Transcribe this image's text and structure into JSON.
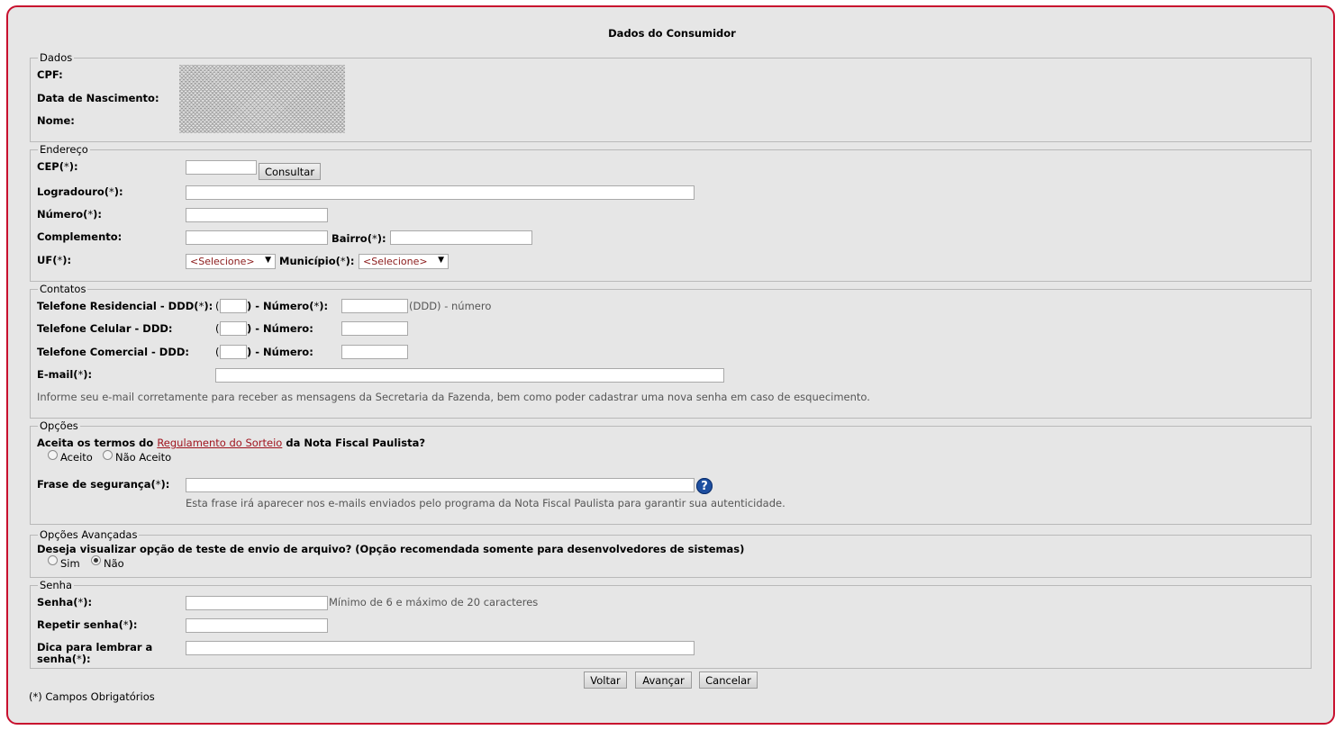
{
  "title": "Dados do Consumidor",
  "dados": {
    "legend": "Dados",
    "cpf_label": "CPF:",
    "nascimento_label": "Data de Nascimento:",
    "nome_label": "Nome:"
  },
  "endereco": {
    "legend": "Endereço",
    "cep_label": "CEP(",
    "logradouro_label": "Logradouro(",
    "numero_label": "Número(",
    "complemento_label": "Complemento:",
    "bairro_label": "Bairro(",
    "uf_label": "UF(",
    "municipio_label": "Município(",
    "consultar_button": "Consultar",
    "uf_selected": "<Selecione>",
    "municipio_selected": "<Selecione>"
  },
  "contatos": {
    "legend": "Contatos",
    "tel_res_label": "Telefone Residencial - DDD(",
    "tel_cel_label": "Telefone Celular - DDD:",
    "tel_com_label": "Telefone Comercial - DDD:",
    "numero_req_label": ") - Número(",
    "numero_label": ") - Número:",
    "paren_open": "(",
    "format_hint": "(DDD) - número",
    "email_label": "E-mail(",
    "email_hint": "Informe seu e-mail corretamente para receber as mensagens da Secretaria da Fazenda, bem como poder cadastrar uma nova senha em caso de esquecimento."
  },
  "opcoes": {
    "legend": "Opções",
    "question_prefix": "Aceita os termos do ",
    "question_link": "Regulamento do Sorteio",
    "question_suffix": " da Nota Fiscal Paulista?",
    "aceito_label": "Aceito",
    "nao_aceito_label": "Não Aceito",
    "frase_label": "Frase de segurança(",
    "frase_hint": "Esta frase irá aparecer nos e-mails enviados pelo programa da Nota Fiscal Paulista para garantir sua autenticidade."
  },
  "avancadas": {
    "legend": "Opções Avançadas",
    "question": "Deseja visualizar opção de teste de envio de arquivo? (Opção recomendada somente para desenvolvedores de sistemas)",
    "sim_label": "Sim",
    "nao_label": "Não",
    "selected": "Não"
  },
  "senha": {
    "legend": "Senha",
    "senha_label": "Senha(",
    "senha_hint": "Mínimo de 6 e máximo de 20 caracteres",
    "repetir_label": "Repetir senha(",
    "dica_label_line1": "Dica para lembrar a",
    "dica_label_line2": "senha("
  },
  "required_marker": "*",
  "close_paren_colon": "):",
  "buttons": {
    "voltar": "Voltar",
    "avancar": "Avançar",
    "cancelar": "Cancelar"
  },
  "footer_note": "(*) Campos Obrigatórios"
}
